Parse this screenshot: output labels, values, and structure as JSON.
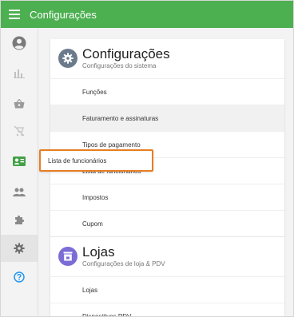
{
  "topbar": {
    "title": "Configurações",
    "menu_icon": "hamburger-menu-icon",
    "color": "#4caf50"
  },
  "sidebar": {
    "items": [
      {
        "icon": "account-circle-icon"
      },
      {
        "icon": "bar-chart-icon"
      },
      {
        "icon": "shopping-basket-icon"
      },
      {
        "icon": "cart-off-icon"
      },
      {
        "icon": "badge-card-icon"
      },
      {
        "icon": "people-icon"
      },
      {
        "icon": "puzzle-icon"
      },
      {
        "icon": "gear-icon",
        "active": true
      },
      {
        "icon": "help-circle-icon"
      }
    ],
    "accent": "#4caf50",
    "help_color": "#2196f3"
  },
  "sections": [
    {
      "title": "Configurações",
      "subtitle": "Configurações do sistema",
      "icon": "gear-icon",
      "icon_color": "#6b7b8c",
      "items": [
        {
          "label": "Funções"
        },
        {
          "label": "Faturamento e assinaturas",
          "highlighted": true
        },
        {
          "label": "Tipos de pagamento"
        },
        {
          "label": "Lista de funcionários"
        },
        {
          "label": "Impostos"
        },
        {
          "label": "Cupom"
        }
      ]
    },
    {
      "title": "Lojas",
      "subtitle": "Configurações de loja & PDV",
      "icon": "store-icon",
      "icon_color": "#7b6cd6",
      "items": [
        {
          "label": "Lojas"
        },
        {
          "label": "Dispositivos PDV"
        }
      ]
    }
  ],
  "tooltip": {
    "text": "Lista de funcionários",
    "border_color": "#e67e22"
  }
}
